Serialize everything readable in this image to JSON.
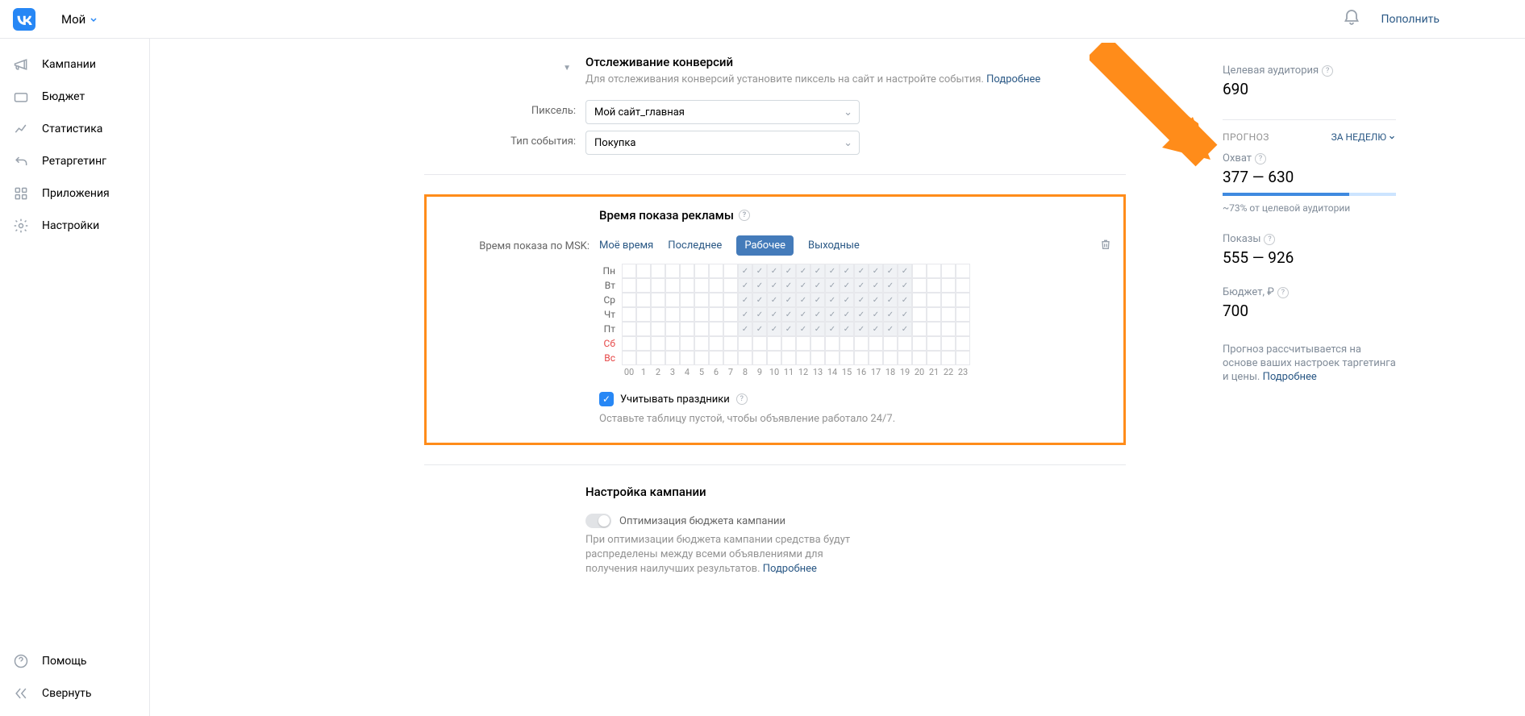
{
  "header": {
    "account": "Мой",
    "topup": "Пополнить"
  },
  "sidebar": {
    "items": [
      {
        "label": "Кампании",
        "name": "sidebar-campaigns"
      },
      {
        "label": "Бюджет",
        "name": "sidebar-budget"
      },
      {
        "label": "Статистика",
        "name": "sidebar-stats"
      },
      {
        "label": "Ретаргетинг",
        "name": "sidebar-retargeting"
      },
      {
        "label": "Приложения",
        "name": "sidebar-apps"
      },
      {
        "label": "Настройки",
        "name": "sidebar-settings"
      }
    ],
    "bottom": [
      {
        "label": "Помощь",
        "name": "sidebar-help"
      },
      {
        "label": "Свернуть",
        "name": "sidebar-collapse"
      }
    ]
  },
  "conversion": {
    "title": "Отслеживание конверсий",
    "desc": "Для отслеживания конверсий установите пиксель на сайт и настройте события. ",
    "more": "Подробнее",
    "pixel_label": "Пиксель:",
    "pixel_value": "Мой сайт_главная",
    "event_label": "Тип события:",
    "event_value": "Покупка"
  },
  "schedule": {
    "title": "Время показа рекламы",
    "tz_label": "Время показа по MSK:",
    "tabs": [
      "Моё время",
      "Последнее",
      "Рабочее",
      "Выходные"
    ],
    "active_tab": "Рабочее",
    "days": [
      "Пн",
      "Вт",
      "Ср",
      "Чт",
      "Пт",
      "Сб",
      "Вс"
    ],
    "hours": [
      "00",
      "1",
      "2",
      "3",
      "4",
      "5",
      "6",
      "7",
      "8",
      "9",
      "10",
      "11",
      "12",
      "13",
      "14",
      "15",
      "16",
      "17",
      "18",
      "19",
      "20",
      "21",
      "22",
      "23"
    ],
    "checkbox_label": "Учитывать праздники",
    "hint": "Оставьте таблицу пустой, чтобы объявление работало 24/7."
  },
  "campaign": {
    "title": "Настройка кампании",
    "opt_label": "Оптимизация бюджета кампании",
    "desc": "При оптимизации бюджета кампании средства будут распределены между всеми объявлениями для получения наилучших результатов. ",
    "more": "Подробнее"
  },
  "panel": {
    "audience_label": "Целевая аудитория",
    "audience_value": "690",
    "forecast_label": "Прогноз",
    "period": "За неделю",
    "reach_label": "Охват",
    "reach_value": "377 — 630",
    "reach_percent": "~73% от целевой аудитории",
    "reach_fill_pct": 73,
    "impressions_label": "Показы",
    "impressions_value": "555 — 926",
    "budget_label": "Бюджет, ₽",
    "budget_value": "700",
    "footer": "Прогноз рассчитывается на основе ваших настроек таргетинга и цены. ",
    "footer_link": "Подробнее"
  }
}
